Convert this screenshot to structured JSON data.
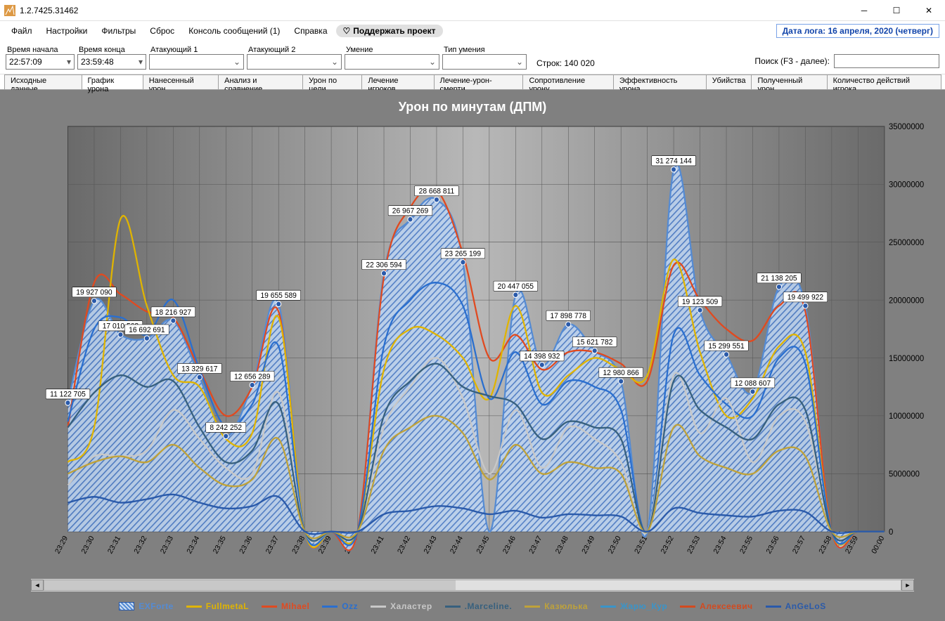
{
  "window": {
    "title": "1.2.7425.31462"
  },
  "menu": {
    "file": "Файл",
    "settings": "Настройки",
    "filters": "Фильтры",
    "reset": "Сброс",
    "console": "Консоль сообщений (1)",
    "help": "Справка",
    "support": "Поддержать проект",
    "logdate": "Дата лога: 16 апреля, 2020  (четверг)"
  },
  "filters": {
    "start_label": "Время начала",
    "start_value": "22:57:09",
    "end_label": "Время конца",
    "end_value": "23:59:48",
    "atk1_label": "Атакующий 1",
    "atk2_label": "Атакующий 2",
    "skill_label": "Умение",
    "skilltype_label": "Тип умения",
    "rows": "Строк: 140 020",
    "search_label": "Поиск (F3 - далее):"
  },
  "tabs": [
    "Исходные данные",
    "График урона",
    "Нанесенный урон",
    "Анализ и сравнение",
    "Урон по цели",
    "Лечение игроков",
    "Лечение-урон-смерти",
    "Сопротивление урону",
    "Эффективность урона",
    "Убийства",
    "Полученный урон",
    "Количество действий игрока"
  ],
  "active_tab": 1,
  "chart_title": "Урон по минутам (ДПМ)",
  "legend": [
    {
      "name": "EXForte",
      "color": "#548bd4",
      "area": true
    },
    {
      "name": "FullmetaL",
      "color": "#e0b400"
    },
    {
      "name": "Mihael",
      "color": "#e04a20"
    },
    {
      "name": "Ozz",
      "color": "#2a6fcf"
    },
    {
      "name": "Халастер",
      "color": "#c8c8c8"
    },
    {
      "name": ".Marceline.",
      "color": "#37607e"
    },
    {
      "name": "Казюлька",
      "color": "#bfa23a"
    },
    {
      "name": "Жарю_Кур",
      "color": "#3a94c9"
    },
    {
      "name": "Алексеевич",
      "color": "#d34a1f"
    },
    {
      "name": "AnGeLoS",
      "color": "#2a5aaa"
    }
  ],
  "chart_data": {
    "type": "line",
    "title": "Урон по минутам (ДПМ)",
    "xlabel": "",
    "ylabel": "",
    "ylim": [
      0,
      35000000
    ],
    "yticks": [
      0,
      5000000,
      10000000,
      15000000,
      20000000,
      25000000,
      30000000,
      35000000
    ],
    "categories": [
      "23:29",
      "23:30",
      "23:31",
      "23:32",
      "23:33",
      "23:34",
      "23:35",
      "23:36",
      "23:37",
      "23:38",
      "23:39",
      "23:40",
      "23:41",
      "23:42",
      "23:43",
      "23:44",
      "23:45",
      "23:46",
      "23:47",
      "23:48",
      "23:49",
      "23:50",
      "23:51",
      "23:52",
      "23:53",
      "23:54",
      "23:55",
      "23:56",
      "23:57",
      "23:58",
      "23:59",
      "00:00"
    ],
    "series": [
      {
        "name": "EXForte",
        "color": "#548bd4",
        "area": true,
        "values": [
          11122705,
          19927090,
          17010568,
          16692691,
          18216927,
          13329617,
          8242252,
          12656289,
          19655589,
          0,
          0,
          0,
          22306594,
          26967269,
          28668811,
          23265199,
          0,
          20447055,
          14398932,
          17898778,
          15621782,
          12980866,
          0,
          31274144,
          19123509,
          15299551,
          12088607,
          21138205,
          19499922,
          0,
          0,
          0
        ],
        "labels": [
          "11 122 705",
          "19 927 090",
          "17 010 568",
          "16 692 691",
          "18 216 927",
          "13 329 617",
          "8 242 252",
          "12 656 289",
          "19 655 589",
          "",
          "",
          "",
          "22 306 594",
          "26 967 269",
          "28 668 811",
          "23 265 199",
          "",
          "20 447 055",
          "14 398 932",
          "17 898 778",
          "15 621 782",
          "12 980 866",
          "",
          "31 274 144",
          "19 123 509",
          "15 299 551",
          "12 088 607",
          "21 138 205",
          "19 499 922",
          "",
          "",
          ""
        ]
      },
      {
        "name": "Mihael",
        "color": "#e04a20",
        "values": [
          9000000,
          21500000,
          20500000,
          19000000,
          18500000,
          14000000,
          10000000,
          12500000,
          19000000,
          0,
          0,
          0,
          22000000,
          28000000,
          29500000,
          24000000,
          15000000,
          17000000,
          14000000,
          15500000,
          15500000,
          14500000,
          13000000,
          23000000,
          20000000,
          17500000,
          16500000,
          19500000,
          19000000,
          0,
          0,
          0
        ]
      },
      {
        "name": "FullmetaL",
        "color": "#e0b400",
        "values": [
          6000000,
          9000000,
          27000000,
          19500000,
          13500000,
          12500000,
          8000000,
          8500000,
          18500000,
          0,
          0,
          0,
          14000000,
          17500000,
          17000000,
          15000000,
          11500000,
          19500000,
          12000000,
          13500000,
          15000000,
          14000000,
          13500000,
          23500000,
          15500000,
          10000000,
          11500000,
          16000000,
          15500000,
          0,
          0,
          0
        ]
      },
      {
        "name": "Ozz",
        "color": "#2a6fcf",
        "values": [
          9500000,
          17500000,
          18500000,
          17000000,
          20000000,
          14000000,
          9000000,
          11000000,
          16000000,
          0,
          0,
          0,
          16000000,
          20000000,
          21500000,
          19500000,
          11500000,
          15500000,
          11000000,
          13000000,
          12500000,
          10500000,
          0,
          17000000,
          13500000,
          11000000,
          10000000,
          15000000,
          14500000,
          0,
          0,
          0
        ]
      },
      {
        "name": "Халастер",
        "color": "#c8c8c8",
        "values": [
          4000000,
          6500000,
          6500000,
          7000000,
          10500000,
          8000000,
          5500000,
          5000000,
          12000000,
          0,
          0,
          0,
          9000000,
          12500000,
          15000000,
          11500000,
          5000000,
          10500000,
          5500000,
          9000000,
          8000000,
          6000000,
          0,
          13500000,
          8500000,
          11500000,
          6000000,
          10000000,
          9500000,
          0,
          0,
          0
        ]
      },
      {
        "name": ".Marceline.",
        "color": "#37607e",
        "values": [
          9000000,
          12000000,
          13500000,
          12500000,
          13000000,
          9000000,
          6000000,
          7000000,
          11000000,
          0,
          0,
          0,
          10000000,
          13000000,
          14500000,
          12500000,
          11708806,
          11000000,
          8000000,
          9500000,
          9000000,
          8000000,
          0,
          13000000,
          10500000,
          9000000,
          8000000,
          11000000,
          10500000,
          0,
          0,
          0
        ]
      },
      {
        "name": "Казюлька",
        "color": "#bfa23a",
        "values": [
          5000000,
          6000000,
          6500000,
          6000000,
          7500000,
          5500000,
          4000000,
          4500000,
          8000000,
          0,
          0,
          0,
          7000000,
          9000000,
          10000000,
          8500000,
          4500000,
          7500000,
          5000000,
          6000000,
          5500000,
          5000000,
          0,
          9000000,
          6500000,
          5500000,
          5000000,
          7000000,
          6500000,
          0,
          0,
          0
        ]
      },
      {
        "name": "AnGeLoS",
        "color": "#2a5aaa",
        "values": [
          2500000,
          3000000,
          2500000,
          2800000,
          3200000,
          2500000,
          2000000,
          2200000,
          3000000,
          0,
          0,
          0,
          1500000,
          1800000,
          2200000,
          2000000,
          1500000,
          1800000,
          1200000,
          1500000,
          1400000,
          1300000,
          0,
          2000000,
          1600000,
          1400000,
          1300000,
          1800000,
          1700000,
          0,
          0,
          0
        ]
      }
    ]
  }
}
